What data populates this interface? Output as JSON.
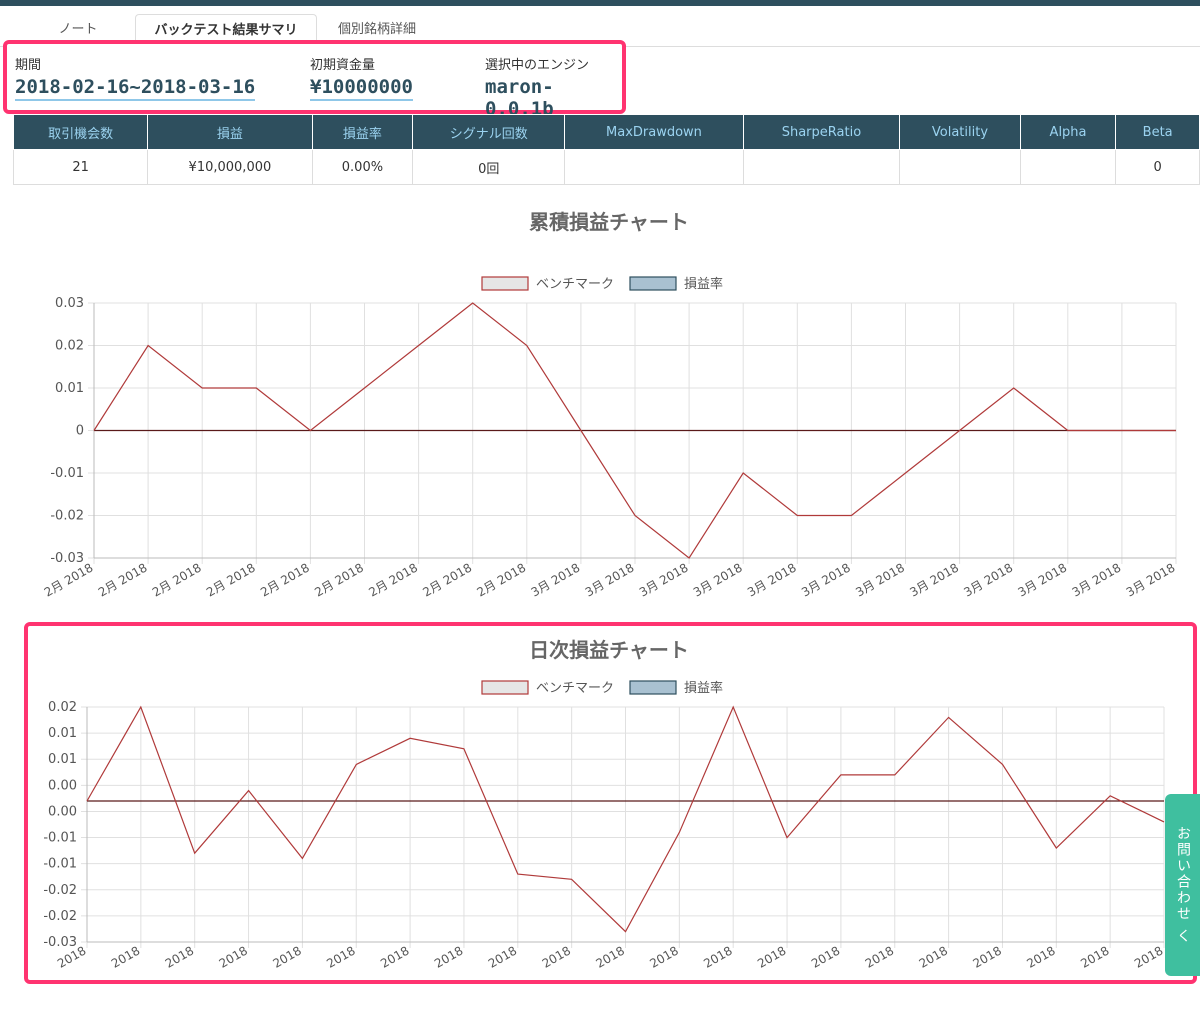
{
  "tabs": [
    {
      "label": "ノート"
    },
    {
      "label": "バックテスト結果サマリ"
    },
    {
      "label": "個別銘柄詳細"
    }
  ],
  "summary": {
    "period_label": "期間",
    "period_value": "2018-02-16~2018-03-16",
    "capital_label": "初期資金量",
    "capital_value": "¥10000000",
    "engine_label": "選択中のエンジン",
    "engine_value": "maron-0.0.1b"
  },
  "stats": {
    "headers": [
      "取引機会数",
      "損益",
      "損益率",
      "シグナル回数",
      "MaxDrawdown",
      "SharpeRatio",
      "Volatility",
      "Alpha",
      "Beta"
    ],
    "row": [
      "21",
      "¥10,000,000",
      "0.00%",
      "0回",
      "",
      "",
      "",
      "",
      "0"
    ]
  },
  "legend": {
    "benchmark": "ベンチマーク",
    "pnl": "損益率"
  },
  "colors": {
    "benchmark": "#b03a3a",
    "pnl_fill": "#a9c1d1",
    "header_bg": "#2e4f5e",
    "accent": "#ff3370",
    "contact": "#3fbf9f"
  },
  "contact_label": "お問い合わせ く",
  "chart_data": [
    {
      "type": "line",
      "title": "累積損益チャート",
      "x": [
        "2月 2018",
        "2月 2018",
        "2月 2018",
        "2月 2018",
        "2月 2018",
        "2月 2018",
        "2月 2018",
        "2月 2018",
        "2月 2018",
        "3月 2018",
        "3月 2018",
        "3月 2018",
        "3月 2018",
        "3月 2018",
        "3月 2018",
        "3月 2018",
        "3月 2018",
        "3月 2018",
        "3月 2018",
        "3月 2018",
        "3月 2018"
      ],
      "yticks": [
        "0.03",
        "0.02",
        "0.01",
        "0",
        "-0.01",
        "-0.02",
        "-0.03"
      ],
      "ylim": [
        -0.03,
        0.03
      ],
      "series": [
        {
          "name": "ベンチマーク",
          "values": [
            0,
            0.02,
            0.01,
            0.01,
            0,
            0.01,
            0.02,
            0.03,
            0.02,
            0,
            -0.02,
            -0.03,
            -0.01,
            -0.02,
            -0.02,
            -0.01,
            0,
            0.01,
            0,
            0,
            0
          ]
        },
        {
          "name": "損益率",
          "values": [
            0,
            0,
            0,
            0,
            0,
            0,
            0,
            0,
            0,
            0,
            0,
            0,
            0,
            0,
            0,
            0,
            0,
            0,
            0,
            0,
            0
          ]
        }
      ],
      "grid": true,
      "legend": "top-center"
    },
    {
      "type": "line",
      "title": "日次損益チャート",
      "x": [
        "2018",
        "2018",
        "2018",
        "2018",
        "2018",
        "2018",
        "2018",
        "2018",
        "2018",
        "2018",
        "2018",
        "2018",
        "2018",
        "2018",
        "2018",
        "2018",
        "2018",
        "2018",
        "2018",
        "2018",
        "2018"
      ],
      "yticks": [
        "0.02",
        "0.01",
        "0.01",
        "0.00",
        "0.00",
        "-0.01",
        "-0.01",
        "-0.02",
        "-0.02",
        "-0.03"
      ],
      "ylim": [
        -0.027,
        0.018
      ],
      "series": [
        {
          "name": "ベンチマーク",
          "values": [
            0,
            0.018,
            -0.01,
            0.002,
            -0.011,
            0.007,
            0.012,
            0.01,
            -0.014,
            -0.015,
            -0.025,
            -0.006,
            0.018,
            -0.007,
            0.005,
            0.005,
            0.016,
            0.007,
            -0.009,
            0.001,
            -0.004
          ]
        },
        {
          "name": "損益率",
          "values": [
            0,
            0,
            0,
            0,
            0,
            0,
            0,
            0,
            0,
            0,
            0,
            0,
            0,
            0,
            0,
            0,
            0,
            0,
            0,
            0,
            0
          ]
        }
      ],
      "grid": true,
      "legend": "top-center"
    }
  ]
}
